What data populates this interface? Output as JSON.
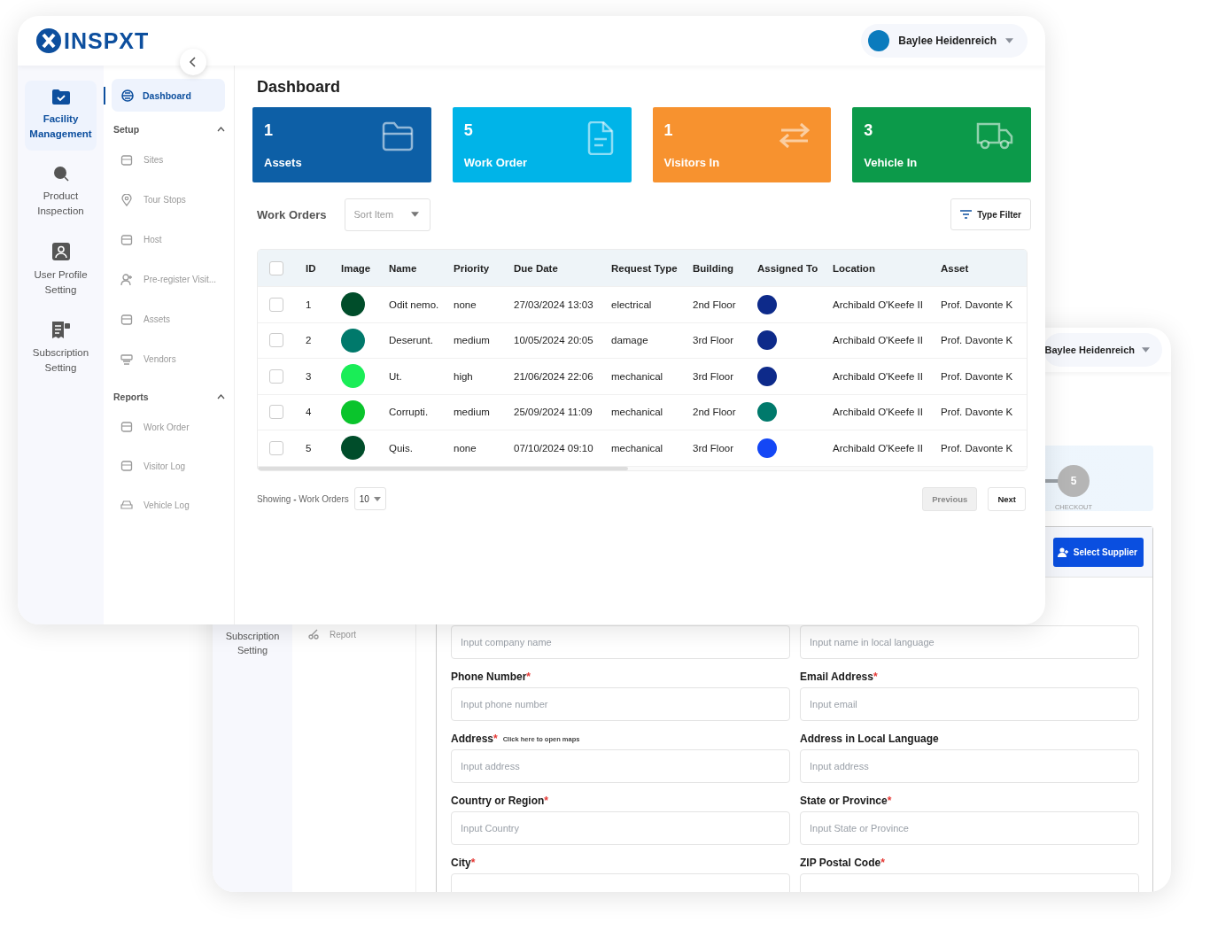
{
  "back_window": {
    "user_menu": {
      "name": "Baylee Heidenreich"
    },
    "rail": [
      {
        "label": "Subscription Setting"
      }
    ],
    "nav": [
      {
        "label": "Report"
      }
    ],
    "stepper": {
      "steps": [
        {
          "number": "5",
          "label": "CHECKOUT",
          "selected": false
        }
      ]
    },
    "select_supplier_button": "Select Supplier",
    "fields": [
      {
        "placeholder": "Input company name"
      },
      {
        "placeholder": "Input name in local language"
      },
      {
        "label": "Phone Number",
        "required_mark": "*",
        "placeholder": "Input phone number"
      },
      {
        "label": "Email Address",
        "required_mark": "*",
        "placeholder": "Input email"
      },
      {
        "label": "Address",
        "required_mark": "*",
        "hint_link": "Click here to open maps",
        "placeholder": "Input address"
      },
      {
        "label": "Address in Local Language",
        "placeholder": "Input address"
      },
      {
        "label": "Country or Region",
        "required_mark": "*",
        "placeholder": "Input Country"
      },
      {
        "label": "State or Province",
        "required_mark": "*",
        "placeholder": "Input State or Province"
      },
      {
        "label": "City",
        "required_mark": "*"
      },
      {
        "label": "ZIP Postal Code",
        "required_mark": "*"
      }
    ]
  },
  "front_window": {
    "logo": "INSPXT",
    "user_menu": {
      "name": "Baylee Heidenreich"
    },
    "rail": [
      {
        "label": "Facility Management",
        "selected": true
      },
      {
        "label": "Product Inspection",
        "selected": false
      },
      {
        "label": "User Profile Setting",
        "selected": false
      },
      {
        "label": "Subscription Setting",
        "selected": false
      }
    ],
    "nav": {
      "top": {
        "label": "Dashboard",
        "selected": true
      },
      "sections": [
        {
          "title": "Setup",
          "expanded": true,
          "items": [
            {
              "label": "Sites"
            },
            {
              "label": "Tour Stops"
            },
            {
              "label": "Host"
            },
            {
              "label": "Pre-register Visit..."
            },
            {
              "label": "Assets"
            },
            {
              "label": "Vendors"
            }
          ]
        },
        {
          "title": "Reports",
          "expanded": true,
          "items": [
            {
              "label": "Work Order"
            },
            {
              "label": "Visitor Log"
            },
            {
              "label": "Vehicle Log"
            }
          ]
        }
      ]
    },
    "page_title": "Dashboard",
    "stats": [
      {
        "value": "1",
        "label": "Assets",
        "color": "#0d5fa6"
      },
      {
        "value": "5",
        "label": "Work Order",
        "color": "#00b4e8"
      },
      {
        "value": "1",
        "label": "Visitors In",
        "color": "#f7922f"
      },
      {
        "value": "3",
        "label": "Vehicle In",
        "color": "#0c9a4a"
      }
    ],
    "work_orders": {
      "title": "Work Orders",
      "sort": {
        "placeholder": "Sort Item"
      },
      "filter_button": "Type Filter",
      "all_selected": false,
      "columns": [
        "ID",
        "Image",
        "Name",
        "Priority",
        "Due Date",
        "Request Type",
        "Building",
        "Assigned To",
        "Location",
        "Asset"
      ],
      "rows": [
        {
          "checked": false,
          "id": "1",
          "name": "Odit nemo.",
          "priority": "none",
          "due_date": "27/03/2024 13:03",
          "request_type": "electrical",
          "building": "2nd Floor",
          "location": "Archibald O'Keefe II",
          "asset": "Prof. Davonte K"
        },
        {
          "checked": false,
          "id": "2",
          "name": "Deserunt.",
          "priority": "medium",
          "due_date": "10/05/2024 20:05",
          "request_type": "damage",
          "building": "3rd Floor",
          "location": "Archibald O'Keefe II",
          "asset": "Prof. Davonte K"
        },
        {
          "checked": false,
          "id": "3",
          "name": "Ut.",
          "priority": "high",
          "due_date": "21/06/2024 22:06",
          "request_type": "mechanical",
          "building": "3rd Floor",
          "location": "Archibald O'Keefe II",
          "asset": "Prof. Davonte K"
        },
        {
          "checked": false,
          "id": "4",
          "name": "Corrupti.",
          "priority": "medium",
          "due_date": "25/09/2024 11:09",
          "request_type": "mechanical",
          "building": "2nd Floor",
          "location": "Archibald O'Keefe II",
          "asset": "Prof. Davonte K"
        },
        {
          "checked": false,
          "id": "5",
          "name": "Quis.",
          "priority": "none",
          "due_date": "07/10/2024 09:10",
          "request_type": "mechanical",
          "building": "3rd Floor",
          "location": "Archibald O'Keefe II",
          "asset": "Prof. Davonte K"
        }
      ],
      "footer": {
        "showing": "Showing **-** Work Orders",
        "page_size": "10",
        "previous": {
          "label": "Previous",
          "disabled": true
        },
        "next": {
          "label": "Next",
          "disabled": false
        }
      }
    }
  }
}
